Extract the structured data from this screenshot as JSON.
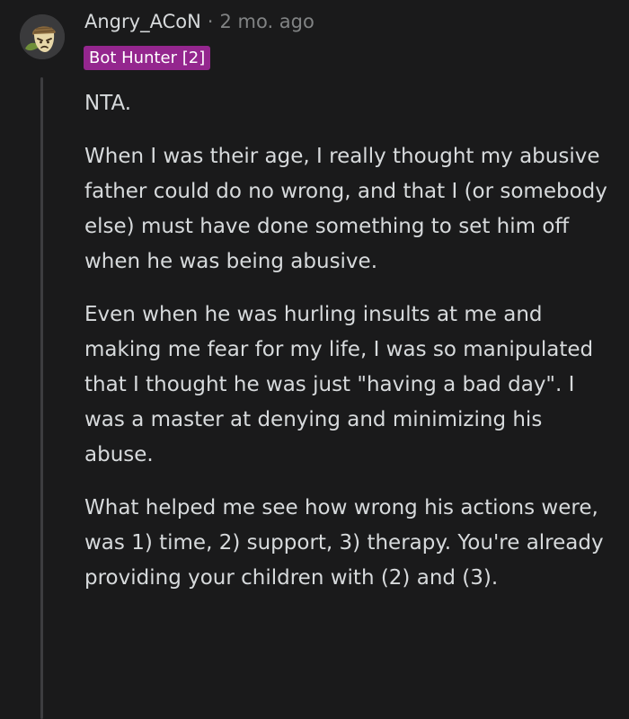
{
  "comment": {
    "author": "Angry_ACoN",
    "separator": "·",
    "timestamp": "2 mo. ago",
    "flair": "Bot Hunter [2]",
    "paragraphs": [
      "NTA.",
      "When I was their age, I really thought my abusive father could do no wrong, and that I (or somebody else) must have done something to set him off when he was being abusive.",
      "Even when he was hurling insults at me and making me fear for my life, I was so manipulated that I thought he was just \"having a bad day\". I was a master at denying and minimizing his abuse.",
      "What helped me see how wrong his actions were, was 1) time, 2) support, 3) therapy. You're already providing your children with (2) and (3)."
    ]
  },
  "avatar": {
    "icon": "acorn-avatar-icon"
  },
  "colors": {
    "background": "#1a1a1b",
    "text": "#d7dadc",
    "meta": "#818384",
    "flair_bg": "#94268e",
    "thread_line": "#3d3d40"
  }
}
